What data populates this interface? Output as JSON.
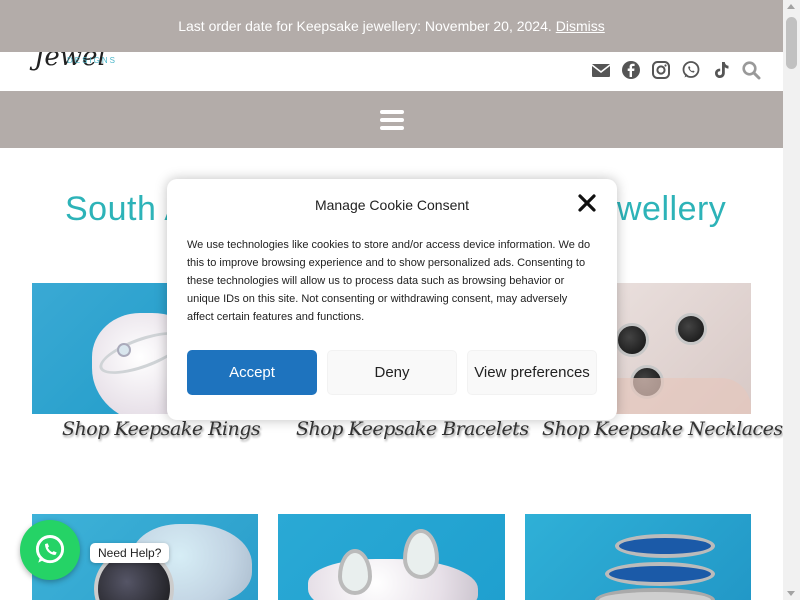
{
  "notice": {
    "text": "Last order date for Keepsake jewellery: November 20, 2024.",
    "dismiss_label": "Dismiss"
  },
  "header": {
    "logo_script": "Jewel",
    "logo_subtitle": "DESIGNS",
    "social_icons": [
      "envelope-icon",
      "facebook-icon",
      "instagram-icon",
      "whatsapp-icon",
      "tiktok-icon",
      "search-icon"
    ]
  },
  "page": {
    "title_left": "South A",
    "title_right": "wellery"
  },
  "products": [
    {
      "caption": "Shop Keepsake Rings"
    },
    {
      "caption": "Shop Keepsake Bracelets"
    },
    {
      "caption": "Shop Keepsake Necklaces"
    }
  ],
  "cookie": {
    "title": "Manage Cookie Consent",
    "body": "We use technologies like cookies to store and/or access device information. We do this to improve browsing experience and to show personalized ads. Consenting to these technologies will allow us to process data such as browsing behavior or unique IDs on this site. Not consenting or withdrawing consent, may adversely affect certain features and functions.",
    "accept_label": "Accept",
    "deny_label": "Deny",
    "prefs_label": "View preferences"
  },
  "whatsapp": {
    "help_label": "Need Help?"
  },
  "colors": {
    "notice_bg": "#b3aca9",
    "accent": "#2db3b8",
    "accept_button": "#1e73be",
    "whatsapp_green": "#25d366"
  }
}
